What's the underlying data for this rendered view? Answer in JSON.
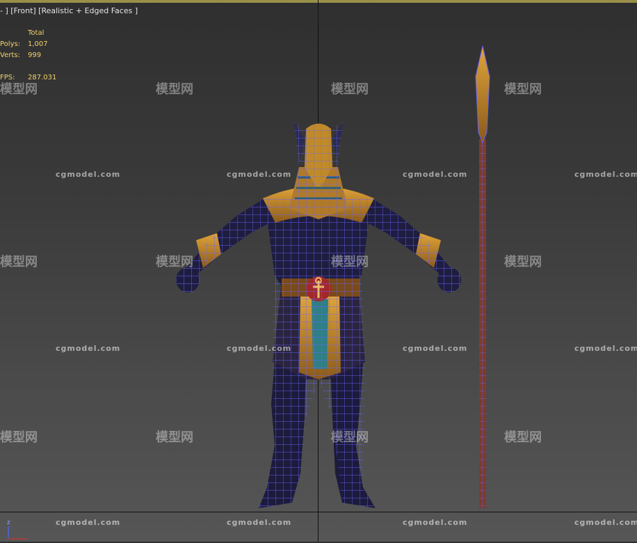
{
  "viewport": {
    "label_parts": [
      "- ]",
      "[Front]",
      "[Realistic + Edged Faces ]"
    ],
    "stats": {
      "header": "Total",
      "rows": [
        {
          "key": "Polys:",
          "value": "1,007"
        },
        {
          "key": "Verts:",
          "value": "999"
        },
        {
          "key": "FPS:",
          "value": "287.031"
        }
      ]
    },
    "gizmo_axis": "z"
  },
  "watermarks": {
    "en": "cgmodel.com",
    "cn": "模型网"
  },
  "colors": {
    "wire": "#6b64ff",
    "gold": "#c98a2a",
    "body": "#1c1b3c",
    "stats": "#f2d36b"
  }
}
